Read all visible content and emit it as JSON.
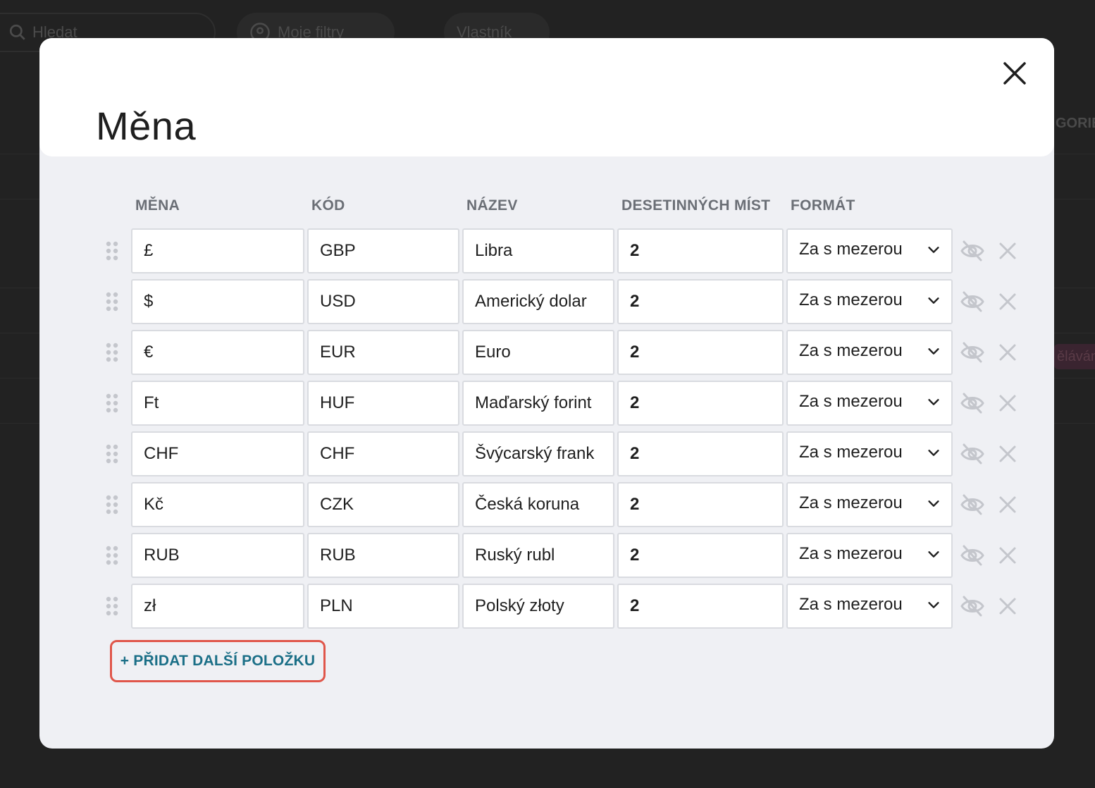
{
  "background": {
    "search_label": "Hledat",
    "filters_label": "Moje filtry",
    "owner_label": "Vlastník",
    "side_header": "GORIE",
    "side_badge": "ěláván"
  },
  "modal": {
    "title": "Měna",
    "columns": [
      "MĚNA",
      "KÓD",
      "NÁZEV",
      "DESETINNÝCH MÍST",
      "FORMÁT"
    ],
    "rows": [
      {
        "symbol": "£",
        "code": "GBP",
        "name": "Libra",
        "decimals": "2",
        "format": "Za s mezerou"
      },
      {
        "symbol": "$",
        "code": "USD",
        "name": "Americký dolar",
        "decimals": "2",
        "format": "Za s mezerou"
      },
      {
        "symbol": "€",
        "code": "EUR",
        "name": "Euro",
        "decimals": "2",
        "format": "Za s mezerou"
      },
      {
        "symbol": "Ft",
        "code": "HUF",
        "name": "Maďarský forint",
        "decimals": "2",
        "format": "Za s mezerou"
      },
      {
        "symbol": "CHF",
        "code": "CHF",
        "name": "Švýcarský frank",
        "decimals": "2",
        "format": "Za s mezerou"
      },
      {
        "symbol": "Kč",
        "code": "CZK",
        "name": "Česká koruna",
        "decimals": "2",
        "format": "Za s mezerou"
      },
      {
        "symbol": "RUB",
        "code": "RUB",
        "name": "Ruský rubl",
        "decimals": "2",
        "format": "Za s mezerou"
      },
      {
        "symbol": "zł",
        "code": "PLN",
        "name": "Polský złoty",
        "decimals": "2",
        "format": "Za s mezerou"
      }
    ],
    "add_button_label": "+ PŘIDAT DALŠÍ POLOŽKU",
    "icons": {
      "close": "close-icon",
      "drag": "drag-handle-icon",
      "visibility": "eye-off-icon",
      "remove": "close-icon",
      "dropdown": "chevron-down-icon"
    },
    "colors": {
      "accent_text": "#1b6f87",
      "highlight_border": "#e0564a",
      "muted_icon": "#c4c6cc"
    }
  }
}
